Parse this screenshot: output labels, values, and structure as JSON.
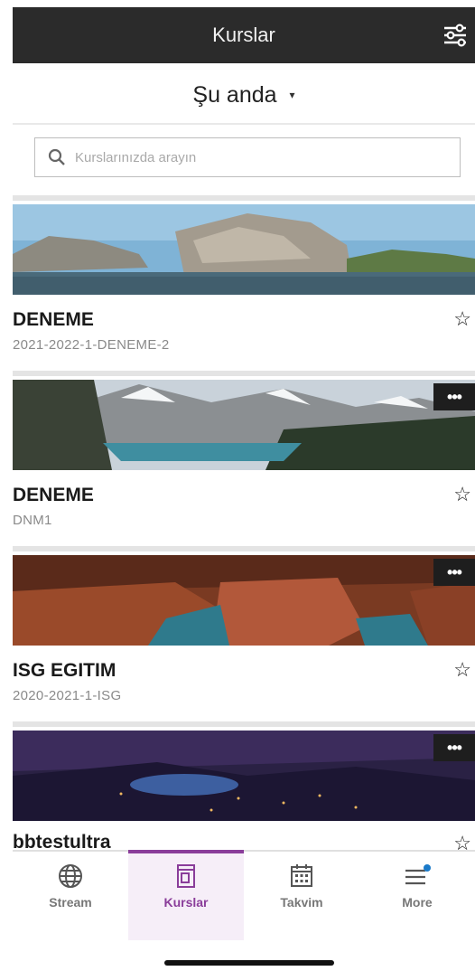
{
  "header": {
    "title": "Kurslar",
    "filter_icon": "sliders-icon"
  },
  "term_selector": {
    "label": "Şu anda",
    "caret": "▾"
  },
  "search": {
    "placeholder": "Kurslarınızda arayın",
    "icon": "search-icon"
  },
  "courses": [
    {
      "title": "DENEME",
      "code": "2021-2022-1-DENEME-2",
      "favorite": false,
      "more_button": false,
      "banner": "rocky-lake"
    },
    {
      "title": "DENEME",
      "code": "DNM1",
      "favorite": false,
      "more_button": true,
      "more_label": "•••",
      "banner": "mountain-lake"
    },
    {
      "title": "ISG EGITIM",
      "code": "2020-2021-1-ISG",
      "favorite": false,
      "more_button": true,
      "more_label": "•••",
      "banner": "canyon"
    },
    {
      "title": "bbtestultra",
      "code": "",
      "favorite": false,
      "more_button": true,
      "more_label": "•••",
      "banner": "night-city"
    }
  ],
  "tabs": [
    {
      "label": "Stream",
      "icon": "globe-icon",
      "active": false
    },
    {
      "label": "Kurslar",
      "icon": "course-book-icon",
      "active": true
    },
    {
      "label": "Takvim",
      "icon": "calendar-icon",
      "active": false
    },
    {
      "label": "More",
      "icon": "menu-icon",
      "active": false,
      "badge": true
    }
  ],
  "colors": {
    "accent": "#8a3d9a",
    "header_bg": "#2b2b2b",
    "badge": "#1a7ac9"
  }
}
